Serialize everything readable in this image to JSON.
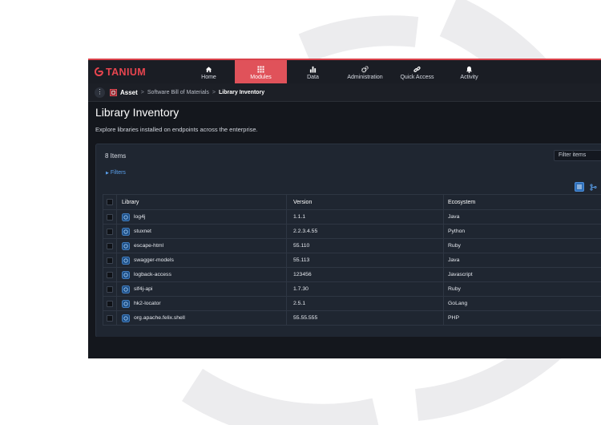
{
  "app": {
    "brand": "TANIUM",
    "brand_color": "#e8454f",
    "accent_active": "#e0525a"
  },
  "nav": {
    "items": [
      {
        "label": "Home",
        "icon": "home-icon",
        "active": false
      },
      {
        "label": "Modules",
        "icon": "grid-icon",
        "active": true
      },
      {
        "label": "Data",
        "icon": "bar-chart-icon",
        "active": false
      },
      {
        "label": "Administration",
        "icon": "gears-icon",
        "active": false
      },
      {
        "label": "Quick Access",
        "icon": "link-icon",
        "active": false
      },
      {
        "label": "Activity",
        "icon": "bell-icon",
        "active": false
      }
    ]
  },
  "breadcrumb": {
    "module": "Asset",
    "items": [
      "Software Bill of Materials",
      "Library Inventory"
    ],
    "separator": ">"
  },
  "page": {
    "title": "Library Inventory",
    "subtitle": "Explore libraries installed on endpoints across the enterprise."
  },
  "panel": {
    "item_count": "8 Items",
    "filter_placeholder": "Filter items",
    "filters_label": "Filters"
  },
  "table": {
    "columns": [
      "Library",
      "Version",
      "Ecosystem"
    ],
    "rows": [
      {
        "library": "log4j",
        "version": "1.1.1",
        "ecosystem": "Java"
      },
      {
        "library": "stuxnet",
        "version": "2.2.3.4.55",
        "ecosystem": "Python"
      },
      {
        "library": "escape-html",
        "version": "55.110",
        "ecosystem": "Ruby"
      },
      {
        "library": "swagger-models",
        "version": "55.113",
        "ecosystem": "Java"
      },
      {
        "library": "logback-access",
        "version": "123456",
        "ecosystem": "Javascript"
      },
      {
        "library": "slf4j-api",
        "version": "1.7.30",
        "ecosystem": "Ruby"
      },
      {
        "library": "hk2-locator",
        "version": "2.5.1",
        "ecosystem": "GoLang"
      },
      {
        "library": "org.apache.felix.shell",
        "version": "55.55.555",
        "ecosystem": "PHP"
      }
    ]
  }
}
